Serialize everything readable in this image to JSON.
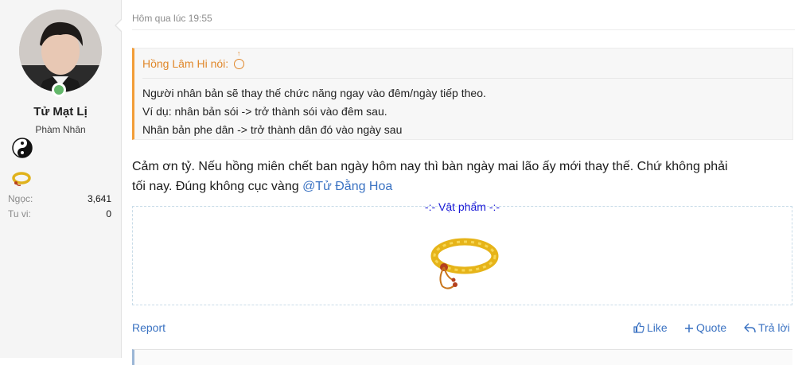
{
  "author": {
    "name": "Tử Mạt Lị",
    "title": "Phàm Nhân",
    "stats": [
      {
        "label": "Ngọc:",
        "value": "3,641"
      },
      {
        "label": "Tu vi:",
        "value": "0"
      }
    ]
  },
  "post": {
    "timestamp": "Hôm qua lúc 19:55",
    "quote": {
      "attribution": "Hồng Lâm Hi nói:",
      "lines": [
        "Người nhân bản sẽ thay thế chức năng ngay vào đêm/ngày tiếp theo.",
        "Ví dụ: nhân bản sói -> trở thành sói vào đêm sau.",
        "Nhân bản phe dân -> trở thành dân đó vào ngày sau"
      ]
    },
    "message_line1": "Cảm ơn tỷ. Nếu hồng miên chết ban ngày hôm nay thì bàn ngày mai lão ấy mới thay thế. Chứ không phải",
    "message_line2_prefix": "tối nay. Đúng không cục vàng ",
    "mention": "@Tử Đằng Hoa",
    "item_title": "-:- Vật phẩm -:-"
  },
  "actions": {
    "report": "Report",
    "like": "Like",
    "quote": "Quote",
    "reply": "Trả lời"
  },
  "colors": {
    "accent_link": "#3a72c2",
    "quote_accent": "#e0872a",
    "item_title": "#1a1ad6",
    "online": "#63b76a"
  },
  "icons": [
    "online-indicator-icon",
    "yinyang-icon",
    "bracelet-icon",
    "arrow-up-circle-icon",
    "thumbs-up-icon",
    "plus-icon",
    "reply-icon"
  ]
}
